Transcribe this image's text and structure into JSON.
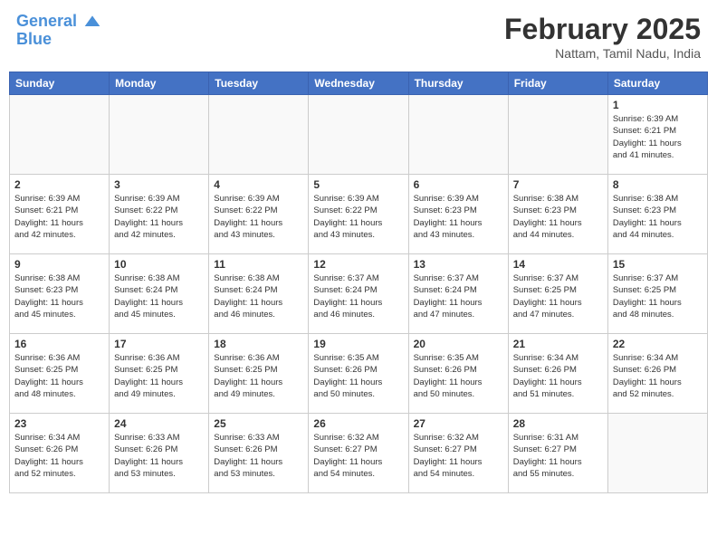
{
  "header": {
    "logo_line1": "General",
    "logo_line2": "Blue",
    "month": "February 2025",
    "location": "Nattam, Tamil Nadu, India"
  },
  "days_of_week": [
    "Sunday",
    "Monday",
    "Tuesday",
    "Wednesday",
    "Thursday",
    "Friday",
    "Saturday"
  ],
  "weeks": [
    [
      {
        "day": "",
        "info": ""
      },
      {
        "day": "",
        "info": ""
      },
      {
        "day": "",
        "info": ""
      },
      {
        "day": "",
        "info": ""
      },
      {
        "day": "",
        "info": ""
      },
      {
        "day": "",
        "info": ""
      },
      {
        "day": "1",
        "info": "Sunrise: 6:39 AM\nSunset: 6:21 PM\nDaylight: 11 hours\nand 41 minutes."
      }
    ],
    [
      {
        "day": "2",
        "info": "Sunrise: 6:39 AM\nSunset: 6:21 PM\nDaylight: 11 hours\nand 42 minutes."
      },
      {
        "day": "3",
        "info": "Sunrise: 6:39 AM\nSunset: 6:22 PM\nDaylight: 11 hours\nand 42 minutes."
      },
      {
        "day": "4",
        "info": "Sunrise: 6:39 AM\nSunset: 6:22 PM\nDaylight: 11 hours\nand 43 minutes."
      },
      {
        "day": "5",
        "info": "Sunrise: 6:39 AM\nSunset: 6:22 PM\nDaylight: 11 hours\nand 43 minutes."
      },
      {
        "day": "6",
        "info": "Sunrise: 6:39 AM\nSunset: 6:23 PM\nDaylight: 11 hours\nand 43 minutes."
      },
      {
        "day": "7",
        "info": "Sunrise: 6:38 AM\nSunset: 6:23 PM\nDaylight: 11 hours\nand 44 minutes."
      },
      {
        "day": "8",
        "info": "Sunrise: 6:38 AM\nSunset: 6:23 PM\nDaylight: 11 hours\nand 44 minutes."
      }
    ],
    [
      {
        "day": "9",
        "info": "Sunrise: 6:38 AM\nSunset: 6:23 PM\nDaylight: 11 hours\nand 45 minutes."
      },
      {
        "day": "10",
        "info": "Sunrise: 6:38 AM\nSunset: 6:24 PM\nDaylight: 11 hours\nand 45 minutes."
      },
      {
        "day": "11",
        "info": "Sunrise: 6:38 AM\nSunset: 6:24 PM\nDaylight: 11 hours\nand 46 minutes."
      },
      {
        "day": "12",
        "info": "Sunrise: 6:37 AM\nSunset: 6:24 PM\nDaylight: 11 hours\nand 46 minutes."
      },
      {
        "day": "13",
        "info": "Sunrise: 6:37 AM\nSunset: 6:24 PM\nDaylight: 11 hours\nand 47 minutes."
      },
      {
        "day": "14",
        "info": "Sunrise: 6:37 AM\nSunset: 6:25 PM\nDaylight: 11 hours\nand 47 minutes."
      },
      {
        "day": "15",
        "info": "Sunrise: 6:37 AM\nSunset: 6:25 PM\nDaylight: 11 hours\nand 48 minutes."
      }
    ],
    [
      {
        "day": "16",
        "info": "Sunrise: 6:36 AM\nSunset: 6:25 PM\nDaylight: 11 hours\nand 48 minutes."
      },
      {
        "day": "17",
        "info": "Sunrise: 6:36 AM\nSunset: 6:25 PM\nDaylight: 11 hours\nand 49 minutes."
      },
      {
        "day": "18",
        "info": "Sunrise: 6:36 AM\nSunset: 6:25 PM\nDaylight: 11 hours\nand 49 minutes."
      },
      {
        "day": "19",
        "info": "Sunrise: 6:35 AM\nSunset: 6:26 PM\nDaylight: 11 hours\nand 50 minutes."
      },
      {
        "day": "20",
        "info": "Sunrise: 6:35 AM\nSunset: 6:26 PM\nDaylight: 11 hours\nand 50 minutes."
      },
      {
        "day": "21",
        "info": "Sunrise: 6:34 AM\nSunset: 6:26 PM\nDaylight: 11 hours\nand 51 minutes."
      },
      {
        "day": "22",
        "info": "Sunrise: 6:34 AM\nSunset: 6:26 PM\nDaylight: 11 hours\nand 52 minutes."
      }
    ],
    [
      {
        "day": "23",
        "info": "Sunrise: 6:34 AM\nSunset: 6:26 PM\nDaylight: 11 hours\nand 52 minutes."
      },
      {
        "day": "24",
        "info": "Sunrise: 6:33 AM\nSunset: 6:26 PM\nDaylight: 11 hours\nand 53 minutes."
      },
      {
        "day": "25",
        "info": "Sunrise: 6:33 AM\nSunset: 6:26 PM\nDaylight: 11 hours\nand 53 minutes."
      },
      {
        "day": "26",
        "info": "Sunrise: 6:32 AM\nSunset: 6:27 PM\nDaylight: 11 hours\nand 54 minutes."
      },
      {
        "day": "27",
        "info": "Sunrise: 6:32 AM\nSunset: 6:27 PM\nDaylight: 11 hours\nand 54 minutes."
      },
      {
        "day": "28",
        "info": "Sunrise: 6:31 AM\nSunset: 6:27 PM\nDaylight: 11 hours\nand 55 minutes."
      },
      {
        "day": "",
        "info": ""
      }
    ]
  ]
}
